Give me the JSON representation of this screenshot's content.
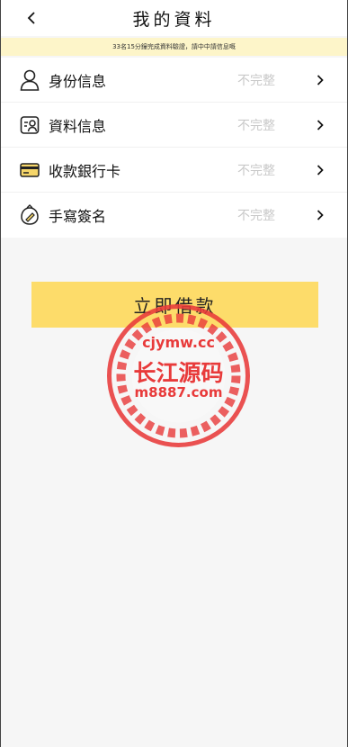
{
  "header": {
    "title": "我的資料",
    "back_icon": "chevron-left-icon"
  },
  "notice": {
    "text": "33名15分鐘完成資料驗證，請中中請信息嘅"
  },
  "rows": [
    {
      "label": "身份信息",
      "status": "不完整",
      "icon": "person-icon"
    },
    {
      "label": "資料信息",
      "status": "不完整",
      "icon": "id-card-icon"
    },
    {
      "label": "收款銀行卡",
      "status": "不完整",
      "icon": "bank-card-icon"
    },
    {
      "label": "手寫簽名",
      "status": "不完整",
      "icon": "signature-icon"
    }
  ],
  "cta": {
    "label": "立即借款"
  },
  "watermark": {
    "line1": "cjymw.cc",
    "line2": "长江源码",
    "line3": "m8887.com"
  },
  "colors": {
    "accent": "#fddc6a",
    "notice_bg": "#fdf5c9",
    "watermark": "#e83a3a",
    "status": "#c9c9c9"
  }
}
